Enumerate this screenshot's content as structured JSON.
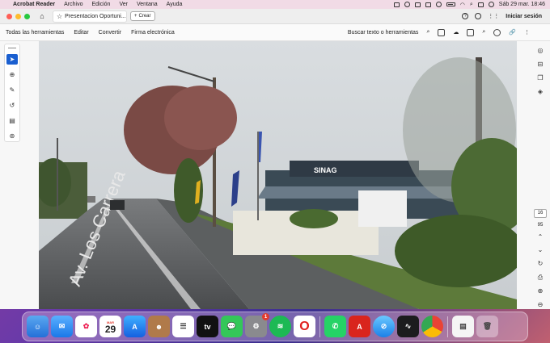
{
  "menubar": {
    "app_name": "Acrobat Reader",
    "items": [
      "Archivo",
      "Edición",
      "Ver",
      "Ventana",
      "Ayuda"
    ],
    "datetime": "Sáb 29 mar.  18:46"
  },
  "titlebar": {
    "tab_title": "Presentacion Oportuni...",
    "create_label": "Crear",
    "signin_label": "Iniciar sesión"
  },
  "toolbar": {
    "items": [
      "Todas las herramientas",
      "Editar",
      "Convertir",
      "Firma electrónica"
    ],
    "search_label": "Buscar texto o herramientas"
  },
  "document": {
    "image_description": "Street view of a wet road with trees and a roadside restaurant",
    "sign_text": "SINAG",
    "road_text": "Av. Los Carrera"
  },
  "rightbar": {
    "page_number": "16",
    "page_total": "95"
  },
  "dock": {
    "calendar_month": "MAR",
    "calendar_day": "29",
    "settings_badge": "1",
    "apps": [
      "finder",
      "mail",
      "photos",
      "calendar",
      "app-store",
      "contacts",
      "reminders",
      "apple-tv",
      "messages",
      "system-settings",
      "spotify",
      "opera",
      "whatsapp",
      "acrobat",
      "safari",
      "voice-memos",
      "chrome",
      "preview",
      "trash"
    ]
  },
  "colors": {
    "accent": "#1a5fd0",
    "menubar_bg": "#f1dbe6"
  }
}
